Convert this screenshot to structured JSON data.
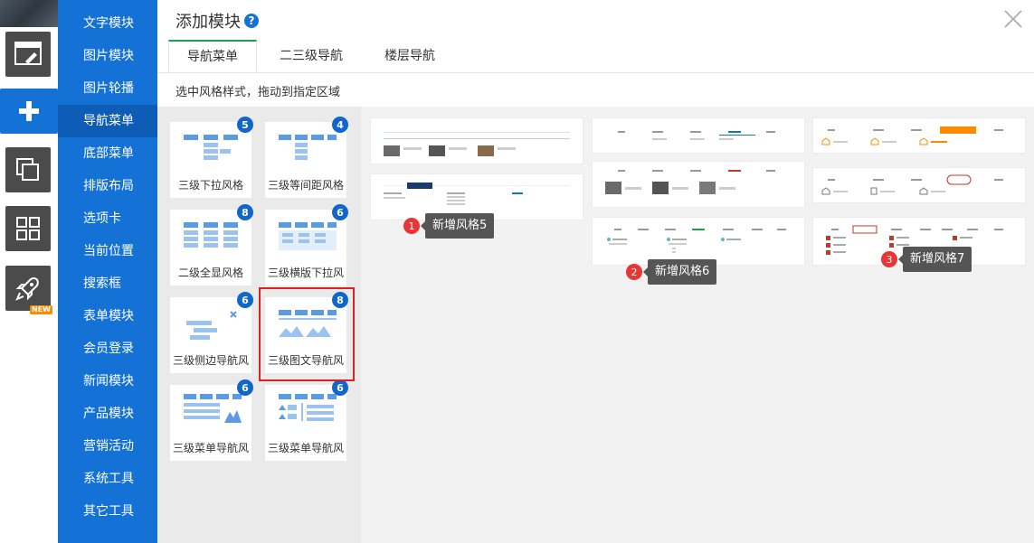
{
  "rail": {
    "icons": [
      "template-icon",
      "add-icon",
      "layers-icon",
      "grid-icon",
      "rocket-icon"
    ],
    "new_badge": "NEW"
  },
  "categories": [
    "文字模块",
    "图片模块",
    "图片轮播",
    "导航菜单",
    "底部菜单",
    "排版布局",
    "选项卡",
    "当前位置",
    "搜索框",
    "表单模块",
    "会员登录",
    "新闻模块",
    "产品模块",
    "营销活动",
    "系统工具",
    "其它工具"
  ],
  "active_category": "导航菜单",
  "dialog": {
    "title": "添加模块",
    "help": "?",
    "tabs": [
      "导航菜单",
      "二三级导航",
      "楼层导航"
    ],
    "active_tab": "导航菜单",
    "hint": "选中风格样式，拖动到指定区域"
  },
  "styles": [
    {
      "label": "三级下拉风格",
      "count": "5",
      "icon": "dropdown-menu-icon"
    },
    {
      "label": "三级等间距风格",
      "count": "4",
      "icon": "equal-spacing-menu-icon"
    },
    {
      "label": "二级全显风格",
      "count": "8",
      "icon": "full-display-menu-icon"
    },
    {
      "label": "三级横版下拉风",
      "count": "6",
      "icon": "horizontal-dropdown-menu-icon"
    },
    {
      "label": "三级侧边导航风",
      "count": "6",
      "icon": "side-nav-menu-icon"
    },
    {
      "label": "三级图文导航风",
      "count": "8",
      "icon": "image-text-nav-icon"
    },
    {
      "label": "三级菜单导航风",
      "count": "6",
      "icon": "menu-nav-icon"
    },
    {
      "label": "三级菜单导航风",
      "count": "6",
      "icon": "menu-nav-alt-icon"
    }
  ],
  "selected_style": "三级图文导航风",
  "tooltips": [
    {
      "num": "1",
      "text": "新增风格5"
    },
    {
      "num": "2",
      "text": "新增风格6"
    },
    {
      "num": "3",
      "text": "新增风格7"
    }
  ],
  "colors": {
    "brand_blue": "#1471d6",
    "active_tab": "#1aa34a",
    "badge": "#1166cc",
    "selection": "#e02020",
    "tip_num": "#e83535",
    "accent_orange": "#ff8a00"
  }
}
